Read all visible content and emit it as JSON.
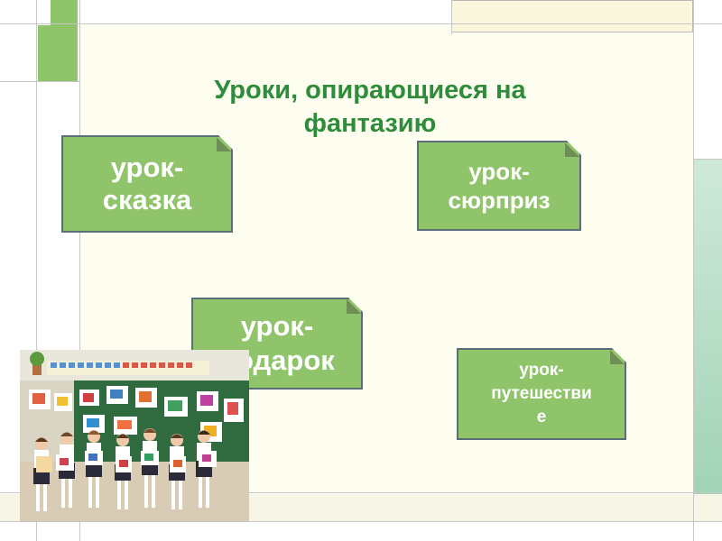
{
  "slide": {
    "title": "Уроки, опирающиеся на\nфантазию",
    "boxes": {
      "fairy_tale": "урок-\nсказка",
      "surprise": "урок-\nсюрприз",
      "gift": "урок-\nподарок",
      "journey": "урок-\nпутешестви\nе"
    }
  },
  "colors": {
    "accent_green": "#8fc46a",
    "title_green": "#2f8c3a"
  },
  "photo": {
    "description_icon": "classroom-children-photo"
  }
}
